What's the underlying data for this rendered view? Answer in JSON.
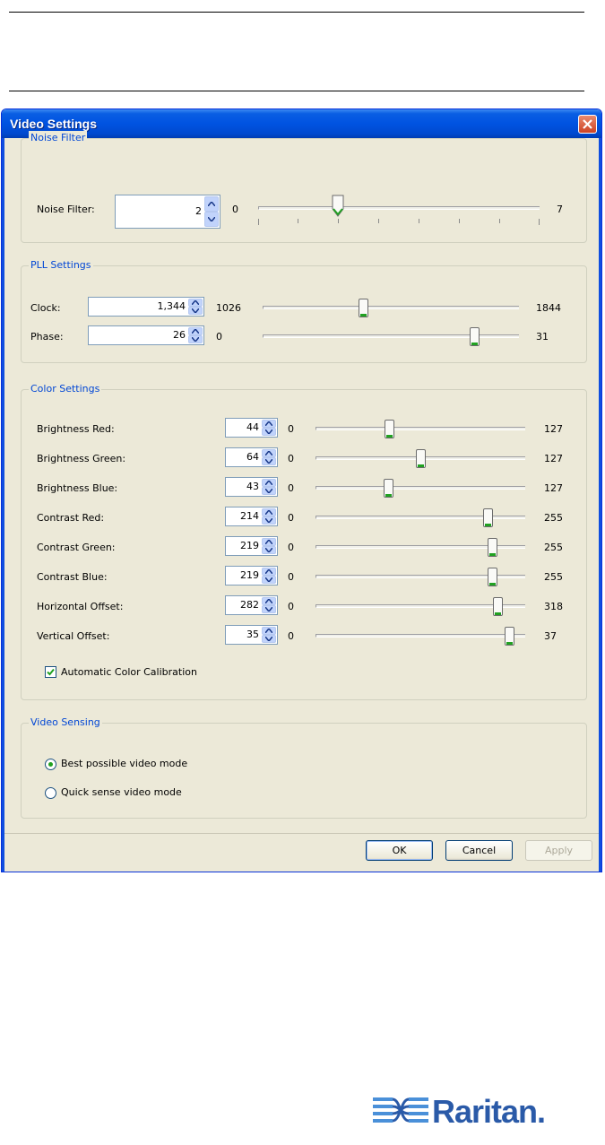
{
  "window": {
    "title": "Video Settings",
    "close_icon": "close-icon"
  },
  "noise_filter": {
    "legend": "Noise Filter",
    "label": "Noise Filter:",
    "value": "2",
    "min": "0",
    "max": "7",
    "level": 2
  },
  "pll": {
    "legend": "PLL Settings",
    "clock": {
      "label": "Clock:",
      "value": "1,344",
      "min": "1026",
      "max": "1844",
      "level": 1344
    },
    "phase": {
      "label": "Phase:",
      "value": "26",
      "min": "0",
      "max": "31",
      "level": 26
    }
  },
  "color": {
    "legend": "Color Settings",
    "rows": [
      {
        "label": "Brightness Red:",
        "value": "44",
        "min": "0",
        "max": "127"
      },
      {
        "label": "Brightness Green:",
        "value": "64",
        "min": "0",
        "max": "127"
      },
      {
        "label": "Brightness Blue:",
        "value": "43",
        "min": "0",
        "max": "127"
      },
      {
        "label": "Contrast Red:",
        "value": "214",
        "min": "0",
        "max": "255"
      },
      {
        "label": "Contrast Green:",
        "value": "219",
        "min": "0",
        "max": "255"
      },
      {
        "label": "Contrast Blue:",
        "value": "219",
        "min": "0",
        "max": "255"
      },
      {
        "label": "Horizontal Offset:",
        "value": "282",
        "min": "0",
        "max": "318"
      },
      {
        "label": "Vertical Offset:",
        "value": "35",
        "min": "0",
        "max": "37"
      }
    ],
    "auto_calibration": {
      "label": "Automatic Color Calibration",
      "checked": true
    }
  },
  "video_sensing": {
    "legend": "Video Sensing",
    "options": [
      {
        "label": "Best possible video mode",
        "selected": true
      },
      {
        "label": "Quick sense video mode",
        "selected": false
      }
    ]
  },
  "buttons": {
    "ok": "OK",
    "cancel": "Cancel",
    "apply": "Apply"
  },
  "logo": {
    "text": "Raritan."
  },
  "colors": {
    "title_bar": "#0053e1",
    "legend": "#0046d5",
    "thumb_accent": "#21a121",
    "dialog_bg": "#ece9d8"
  }
}
